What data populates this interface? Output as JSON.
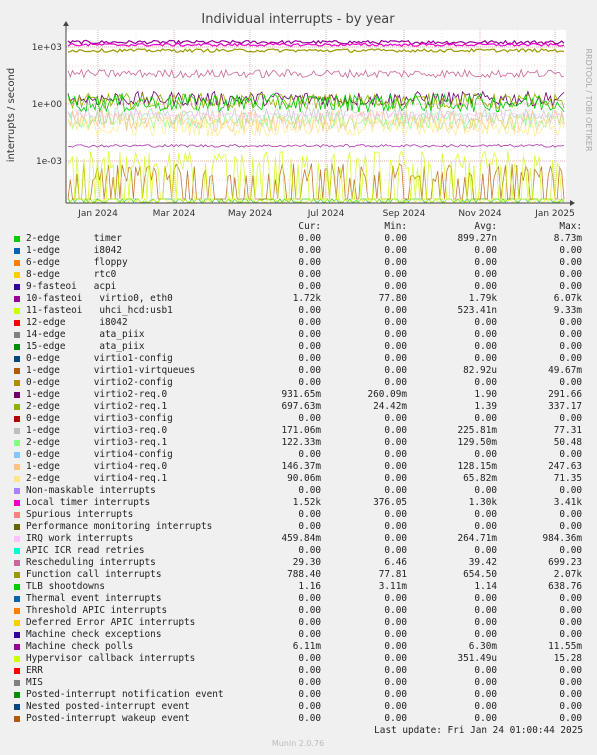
{
  "chart_data": {
    "type": "line",
    "title": "Individual interrupts - by year",
    "ylabel": "interrupts / second",
    "y_scale": "log",
    "y_ticks": [
      "1e+03",
      "1e+00",
      "1e-03"
    ],
    "x_ticks": [
      "Jan 2024",
      "Mar 2024",
      "May 2024",
      "Jul 2024",
      "Sep 2024",
      "Nov 2024",
      "Jan 2025"
    ],
    "side_label": "RRDTOOL / TOBI OETIKER",
    "grid": true,
    "legend_columns": [
      "Cur:",
      "Min:",
      "Avg:",
      "Max:"
    ],
    "series": [
      {
        "name": "2-edge      timer",
        "color": "#00cc00",
        "cur": "0.00",
        "min": "0.00",
        "avg": "899.27n",
        "max": "8.73m"
      },
      {
        "name": "1-edge      i8042",
        "color": "#0066b3",
        "cur": "0.00",
        "min": "0.00",
        "avg": "0.00",
        "max": "0.00"
      },
      {
        "name": "6-edge      floppy",
        "color": "#ff8000",
        "cur": "0.00",
        "min": "0.00",
        "avg": "0.00",
        "max": "0.00"
      },
      {
        "name": "8-edge      rtc0",
        "color": "#ffcc00",
        "cur": "0.00",
        "min": "0.00",
        "avg": "0.00",
        "max": "0.00"
      },
      {
        "name": "9-fasteoi   acpi",
        "color": "#330099",
        "cur": "0.00",
        "min": "0.00",
        "avg": "0.00",
        "max": "0.00"
      },
      {
        "name": "10-fasteoi   virtio0, eth0",
        "color": "#990099",
        "cur": "1.72k",
        "min": "77.80",
        "avg": "1.79k",
        "max": "6.07k"
      },
      {
        "name": "11-fasteoi   uhci_hcd:usb1",
        "color": "#ccff00",
        "cur": "0.00",
        "min": "0.00",
        "avg": "523.41n",
        "max": "9.33m"
      },
      {
        "name": "12-edge      i8042",
        "color": "#ff0000",
        "cur": "0.00",
        "min": "0.00",
        "avg": "0.00",
        "max": "0.00"
      },
      {
        "name": "14-edge      ata_piix",
        "color": "#808080",
        "cur": "0.00",
        "min": "0.00",
        "avg": "0.00",
        "max": "0.00"
      },
      {
        "name": "15-edge      ata_piix",
        "color": "#008f00",
        "cur": "0.00",
        "min": "0.00",
        "avg": "0.00",
        "max": "0.00"
      },
      {
        "name": "0-edge      virtio1-config",
        "color": "#00487d",
        "cur": "0.00",
        "min": "0.00",
        "avg": "0.00",
        "max": "0.00"
      },
      {
        "name": "1-edge      virtio1-virtqueues",
        "color": "#b35a00",
        "cur": "0.00",
        "min": "0.00",
        "avg": "82.92u",
        "max": "49.67m"
      },
      {
        "name": "0-edge      virtio2-config",
        "color": "#b38f00",
        "cur": "0.00",
        "min": "0.00",
        "avg": "0.00",
        "max": "0.00"
      },
      {
        "name": "1-edge      virtio2-req.0",
        "color": "#6b006b",
        "cur": "931.65m",
        "min": "260.09m",
        "avg": "1.90",
        "max": "291.66"
      },
      {
        "name": "2-edge      virtio2-req.1",
        "color": "#8fb300",
        "cur": "697.63m",
        "min": "24.42m",
        "avg": "1.39",
        "max": "337.17"
      },
      {
        "name": "0-edge      virtio3-config",
        "color": "#b30000",
        "cur": "0.00",
        "min": "0.00",
        "avg": "0.00",
        "max": "0.00"
      },
      {
        "name": "1-edge      virtio3-req.0",
        "color": "#bebebe",
        "cur": "171.06m",
        "min": "0.00",
        "avg": "225.81m",
        "max": "77.31"
      },
      {
        "name": "2-edge      virtio3-req.1",
        "color": "#80ff80",
        "cur": "122.33m",
        "min": "0.00",
        "avg": "129.50m",
        "max": "50.48"
      },
      {
        "name": "0-edge      virtio4-config",
        "color": "#80c9ff",
        "cur": "0.00",
        "min": "0.00",
        "avg": "0.00",
        "max": "0.00"
      },
      {
        "name": "1-edge      virtio4-req.0",
        "color": "#ffc080",
        "cur": "146.37m",
        "min": "0.00",
        "avg": "128.15m",
        "max": "247.63"
      },
      {
        "name": "2-edge      virtio4-req.1",
        "color": "#ffe680",
        "cur": "90.06m",
        "min": "0.00",
        "avg": "65.82m",
        "max": "71.35"
      },
      {
        "name": "Non-maskable interrupts",
        "color": "#aa80ff",
        "cur": "0.00",
        "min": "0.00",
        "avg": "0.00",
        "max": "0.00"
      },
      {
        "name": "Local timer interrupts",
        "color": "#ee00cc",
        "cur": "1.52k",
        "min": "376.05",
        "avg": "1.30k",
        "max": "3.41k"
      },
      {
        "name": "Spurious interrupts",
        "color": "#ff8080",
        "cur": "0.00",
        "min": "0.00",
        "avg": "0.00",
        "max": "0.00"
      },
      {
        "name": "Performance monitoring interrupts",
        "color": "#666600",
        "cur": "0.00",
        "min": "0.00",
        "avg": "0.00",
        "max": "0.00"
      },
      {
        "name": "IRQ work interrupts",
        "color": "#ffbfff",
        "cur": "459.84m",
        "min": "0.00",
        "avg": "264.71m",
        "max": "984.36m"
      },
      {
        "name": "APIC ICR read retries",
        "color": "#00ffcc",
        "cur": "0.00",
        "min": "0.00",
        "avg": "0.00",
        "max": "0.00"
      },
      {
        "name": "Rescheduling interrupts",
        "color": "#cc6699",
        "cur": "29.30",
        "min": "6.46",
        "avg": "39.42",
        "max": "699.23"
      },
      {
        "name": "Function call interrupts",
        "color": "#999900",
        "cur": "788.40",
        "min": "77.81",
        "avg": "654.50",
        "max": "2.07k"
      },
      {
        "name": "TLB shootdowns",
        "color": "#00cc00",
        "cur": "1.16",
        "min": "3.11m",
        "avg": "1.14",
        "max": "638.76"
      },
      {
        "name": "Thermal event interrupts",
        "color": "#0066b3",
        "cur": "0.00",
        "min": "0.00",
        "avg": "0.00",
        "max": "0.00"
      },
      {
        "name": "Threshold APIC interrupts",
        "color": "#ff8000",
        "cur": "0.00",
        "min": "0.00",
        "avg": "0.00",
        "max": "0.00"
      },
      {
        "name": "Deferred Error APIC interrupts",
        "color": "#ffcc00",
        "cur": "0.00",
        "min": "0.00",
        "avg": "0.00",
        "max": "0.00"
      },
      {
        "name": "Machine check exceptions",
        "color": "#330099",
        "cur": "0.00",
        "min": "0.00",
        "avg": "0.00",
        "max": "0.00"
      },
      {
        "name": "Machine check polls",
        "color": "#990099",
        "cur": "6.11m",
        "min": "0.00",
        "avg": "6.30m",
        "max": "11.55m"
      },
      {
        "name": "Hypervisor callback interrupts",
        "color": "#ccff00",
        "cur": "0.00",
        "min": "0.00",
        "avg": "351.49u",
        "max": "15.28"
      },
      {
        "name": "ERR",
        "color": "#ff0000",
        "cur": "0.00",
        "min": "0.00",
        "avg": "0.00",
        "max": "0.00"
      },
      {
        "name": "MIS",
        "color": "#808080",
        "cur": "0.00",
        "min": "0.00",
        "avg": "0.00",
        "max": "0.00"
      },
      {
        "name": "Posted-interrupt notification event",
        "color": "#008f00",
        "cur": "0.00",
        "min": "0.00",
        "avg": "0.00",
        "max": "0.00"
      },
      {
        "name": "Nested posted-interrupt event",
        "color": "#00487d",
        "cur": "0.00",
        "min": "0.00",
        "avg": "0.00",
        "max": "0.00"
      },
      {
        "name": "Posted-interrupt wakeup event",
        "color": "#b35a00",
        "cur": "0.00",
        "min": "0.00",
        "avg": "0.00",
        "max": "0.00"
      }
    ]
  },
  "last_update": "Last update: Fri Jan 24 01:00:44 2025",
  "footer": "Munin 2.0.76"
}
